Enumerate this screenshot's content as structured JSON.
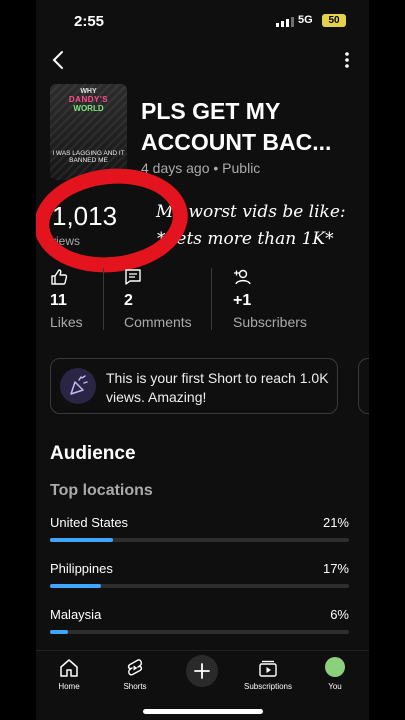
{
  "status_bar": {
    "time": "2:55",
    "network": "5G",
    "battery": "50"
  },
  "video": {
    "title_line1": "PLS GET MY",
    "title_line2": "ACCOUNT BAC...",
    "meta": "4 days ago • Public",
    "thumbnail": {
      "line1": "WHY",
      "line2": "DANDY'S",
      "line3": "WORLD",
      "caption": "I WAS LAGGING AND IT BANNED ME"
    }
  },
  "views": {
    "count": "1,013",
    "label": "views"
  },
  "overlay_text": {
    "line1": "My worst vids be like:",
    "line2": "*gets more than 1K*"
  },
  "stats": [
    {
      "icon": "thumbs-up-icon",
      "value": "11",
      "label": "Likes"
    },
    {
      "icon": "comment-icon",
      "value": "2",
      "label": "Comments"
    },
    {
      "icon": "add-person-icon",
      "value": "+1",
      "label": "Subscribers"
    }
  ],
  "milestone": {
    "icon": "party-popper-icon",
    "text": "This is your first Short to reach 1.0K views. Amazing!"
  },
  "audience": {
    "heading": "Audience",
    "subheading": "Top locations",
    "locations": [
      {
        "name": "United States",
        "percent": "21%",
        "share": 0.21
      },
      {
        "name": "Philippines",
        "percent": "17%",
        "share": 0.17
      },
      {
        "name": "Malaysia",
        "percent": "6%",
        "share": 0.06
      }
    ]
  },
  "nav": {
    "home": "Home",
    "shorts": "Shorts",
    "subscriptions": "Subscriptions",
    "you": "You"
  },
  "colors": {
    "accent": "#3ea6ff",
    "highlight_ring": "#e4141e",
    "background": "#0f0f0f"
  }
}
